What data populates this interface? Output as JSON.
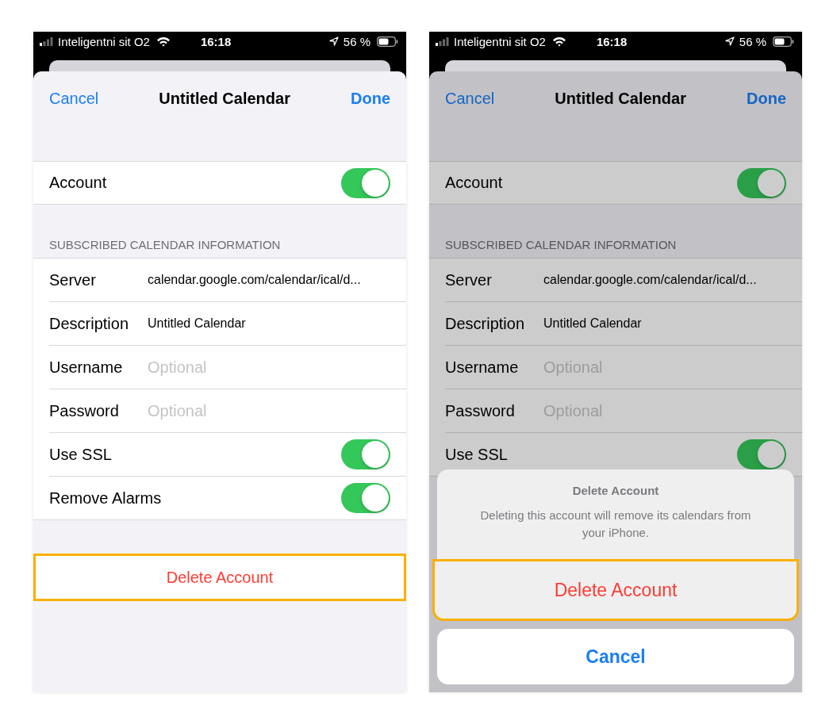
{
  "screens": [
    {
      "dimmed": false,
      "status_bar": {
        "carrier": "Inteligentni sit O2",
        "time": "16:18",
        "battery": "56 %"
      },
      "nav": {
        "cancel": "Cancel",
        "title": "Untitled Calendar",
        "done": "Done"
      },
      "account": {
        "label": "Account",
        "on": true
      },
      "section_header": "SUBSCRIBED CALENDAR INFORMATION",
      "rows": [
        {
          "kind": "text",
          "label": "Server",
          "value": "calendar.google.com/calendar/ical/d..."
        },
        {
          "kind": "text",
          "label": "Description",
          "value": "Untitled Calendar"
        },
        {
          "kind": "field",
          "label": "Username",
          "placeholder": "Optional"
        },
        {
          "kind": "field",
          "label": "Password",
          "placeholder": "Optional"
        },
        {
          "kind": "toggle",
          "label": "Use SSL",
          "on": true
        },
        {
          "kind": "toggle",
          "label": "Remove Alarms",
          "on": true
        }
      ],
      "delete_button": {
        "label": "Delete Account",
        "highlighted": true
      }
    },
    {
      "dimmed": true,
      "status_bar": {
        "carrier": "Inteligentni sit O2",
        "time": "16:18",
        "battery": "56 %"
      },
      "nav": {
        "cancel": "Cancel",
        "title": "Untitled Calendar",
        "done": "Done"
      },
      "account": {
        "label": "Account",
        "on": true
      },
      "section_header": "SUBSCRIBED CALENDAR INFORMATION",
      "rows": [
        {
          "kind": "text",
          "label": "Server",
          "value": "calendar.google.com/calendar/ical/d..."
        },
        {
          "kind": "text",
          "label": "Description",
          "value": "Untitled Calendar"
        },
        {
          "kind": "field",
          "label": "Username",
          "placeholder": "Optional"
        },
        {
          "kind": "field",
          "label": "Password",
          "placeholder": "Optional"
        },
        {
          "kind": "toggle",
          "label": "Use SSL",
          "on": true
        }
      ],
      "action_sheet": {
        "title": "Delete Account",
        "message": "Deleting this account will remove its calendars from your iPhone.",
        "destructive": {
          "label": "Delete Account",
          "highlighted": true
        },
        "cancel": "Cancel"
      }
    }
  ]
}
